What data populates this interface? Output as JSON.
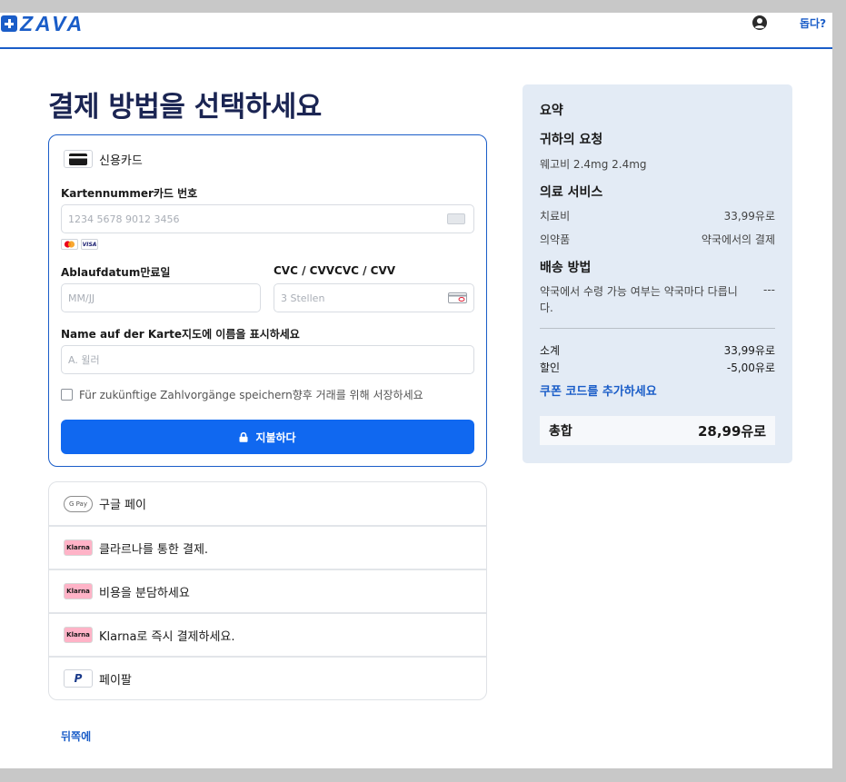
{
  "header": {
    "logo_text": "ZAVA",
    "help_label": "돕다?"
  },
  "page_title": "결제 방법을 선택하세요",
  "credit_card": {
    "label": "신용카드",
    "card_number_label": "Kartennummer카드 번호",
    "card_number_placeholder": "1234 5678 9012 3456",
    "expiry_label": "Ablaufdatum만료일",
    "expiry_placeholder": "MM/JJ",
    "cvc_label": "CVC / CVVCVC / CVV",
    "cvc_placeholder": "3 Stellen",
    "name_label": "Name auf der Karte지도에 이름을 표시하세요",
    "name_placeholder": "A. 윌러",
    "save_label": "Für zukünftige Zahlvorgänge speichern향후 거래를 위해 서장하세요",
    "pay_button": "지불하다",
    "brands": [
      "mastercard",
      "VISA"
    ]
  },
  "other_methods": [
    {
      "icon": "gpay-icon",
      "badge": "G Pay",
      "label": "구글 페이"
    },
    {
      "icon": "klarna-icon",
      "badge": "Klarna",
      "label": "클라르나를 통한 결제."
    },
    {
      "icon": "klarna-icon",
      "badge": "Klarna",
      "label": "비용을 분담하세요"
    },
    {
      "icon": "klarna-icon",
      "badge": "Klarna",
      "label": "Klarna로 즉시 결제하세요."
    },
    {
      "icon": "paypal-icon",
      "badge": "P",
      "label": "페이팔"
    }
  ],
  "back_link": "뒤쪽에",
  "summary": {
    "title": "요약",
    "request_heading": "귀하의 요청",
    "request_item": "웨고비 2.4mg 2.4mg",
    "medical_heading": "의료 서비스",
    "treatment_fee_label": "치료비",
    "treatment_fee_value": "33,99유로",
    "medicine_label": "의약품",
    "medicine_value": "약국에서의 결제",
    "shipping_heading": "배송 방법",
    "shipping_text": "약국에서 수령 가능 여부는 약국마다 다릅니다.",
    "shipping_value": "---",
    "subtotal_label": "소계",
    "subtotal_value": "33,99유로",
    "discount_label": "할인",
    "discount_value": "-5,00유로",
    "coupon_link": "쿠폰 코드를 추가하세요",
    "total_label": "총합",
    "total_value": "28,99유로"
  },
  "colors": {
    "brand": "#1a5dc8",
    "pay_button": "#1068f0",
    "summary_bg": "#e3ebf5",
    "title": "#1b2553"
  }
}
